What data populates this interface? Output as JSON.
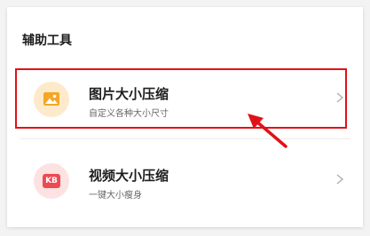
{
  "section": {
    "title": "辅助工具"
  },
  "tools": [
    {
      "title": "图片大小压缩",
      "desc": "自定义各种大小尺寸",
      "icon": "image-icon",
      "icon_color": "#f5a623"
    },
    {
      "title": "视频大小压缩",
      "desc": "一键大小瘦身",
      "icon": "kb-icon",
      "icon_label": "KB",
      "icon_color": "#ee4a52"
    }
  ],
  "annotation": {
    "color": "#e01218",
    "icon": "arrow-icon"
  }
}
